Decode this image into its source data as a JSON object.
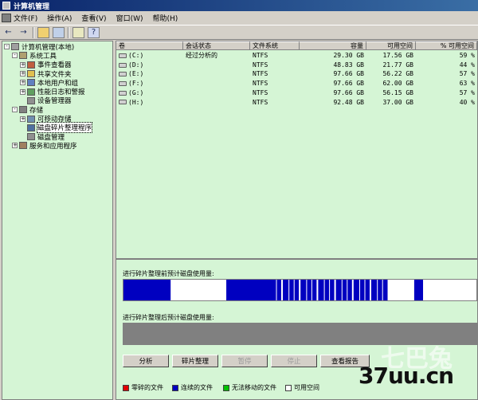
{
  "window": {
    "title": "计算机管理"
  },
  "menu": [
    {
      "label": "文件(F)"
    },
    {
      "label": "操作(A)"
    },
    {
      "label": "查看(V)"
    },
    {
      "label": "窗口(W)"
    },
    {
      "label": "帮助(H)"
    }
  ],
  "tree": [
    {
      "label": "计算机管理(本地)",
      "level": 0,
      "expander": "-",
      "icon": "computer-icon",
      "color": "#a0a0a0"
    },
    {
      "label": "系统工具",
      "level": 1,
      "expander": "-",
      "icon": "tools-icon",
      "color": "#b0a070"
    },
    {
      "label": "事件查看器",
      "level": 2,
      "expander": "+",
      "icon": "event-viewer-icon",
      "color": "#c06040"
    },
    {
      "label": "共享文件夹",
      "level": 2,
      "expander": "+",
      "icon": "shared-folder-icon",
      "color": "#e0c050"
    },
    {
      "label": "本地用户和组",
      "level": 2,
      "expander": "+",
      "icon": "users-icon",
      "color": "#6080c0"
    },
    {
      "label": "性能日志和警报",
      "level": 2,
      "expander": "+",
      "icon": "performance-icon",
      "color": "#60a060"
    },
    {
      "label": "设备管理器",
      "level": 2,
      "expander": "",
      "icon": "device-manager-icon",
      "color": "#909090"
    },
    {
      "label": "存储",
      "level": 1,
      "expander": "-",
      "icon": "storage-icon",
      "color": "#808080"
    },
    {
      "label": "可移动存储",
      "level": 2,
      "expander": "+",
      "icon": "removable-storage-icon",
      "color": "#7090b0"
    },
    {
      "label": "磁盘碎片整理程序",
      "level": 2,
      "expander": "",
      "icon": "defrag-icon",
      "color": "#5070a0",
      "selected": true
    },
    {
      "label": "磁盘管理",
      "level": 2,
      "expander": "",
      "icon": "disk-management-icon",
      "color": "#909090"
    },
    {
      "label": "服务和应用程序",
      "level": 1,
      "expander": "+",
      "icon": "services-icon",
      "color": "#a08060"
    }
  ],
  "volumes": {
    "columns": [
      "卷",
      "会话状态",
      "文件系统",
      "容量",
      "可用空间",
      "% 可用空间"
    ],
    "rows": [
      [
        "(C:)",
        "经过分析的",
        "NTFS",
        "29.30 GB",
        "17.56 GB",
        "59 %"
      ],
      [
        "(D:)",
        "",
        "NTFS",
        "48.83 GB",
        "21.77 GB",
        "44 %"
      ],
      [
        "(E:)",
        "",
        "NTFS",
        "97.66 GB",
        "56.22 GB",
        "57 %"
      ],
      [
        "(F:)",
        "",
        "NTFS",
        "97.66 GB",
        "62.00 GB",
        "63 %"
      ],
      [
        "(G:)",
        "",
        "NTFS",
        "97.66 GB",
        "56.15 GB",
        "57 %"
      ],
      [
        "(H:)",
        "",
        "NTFS",
        "92.48 GB",
        "37.00 GB",
        "40 %"
      ]
    ]
  },
  "before": {
    "label": "进行碎片整理前预计磁盘使用量:"
  },
  "after": {
    "label": "进行碎片整理后预计磁盘使用量:"
  },
  "buttons": {
    "analyze": "分析",
    "defragment": "碎片整理",
    "pause": "暂停",
    "stop": "停止",
    "view_report": "查看报告"
  },
  "legend": [
    {
      "label": "零碎的文件",
      "color": "#e00000"
    },
    {
      "label": "连续的文件",
      "color": "#0000c0"
    },
    {
      "label": "无法移动的文件",
      "color": "#00c000"
    },
    {
      "label": "可用空间",
      "color": "#ffffff"
    }
  ],
  "watermark": {
    "text": "37uu.cn",
    "faded": "七巴兔"
  },
  "colors": {
    "pane_bg": "#d5f5d5",
    "title_bg": "#0a246a",
    "bar_gray": "#808080"
  },
  "usage_before": [
    {
      "type": "used",
      "start": 0.0,
      "end": 0.133
    },
    {
      "type": "free",
      "start": 0.133,
      "end": 0.29
    },
    {
      "type": "used",
      "start": 0.29,
      "end": 0.745
    },
    {
      "type": "free",
      "start": 0.745,
      "end": 0.82
    },
    {
      "type": "used",
      "start": 0.82,
      "end": 0.845
    },
    {
      "type": "free",
      "start": 0.845,
      "end": 1.0
    }
  ]
}
